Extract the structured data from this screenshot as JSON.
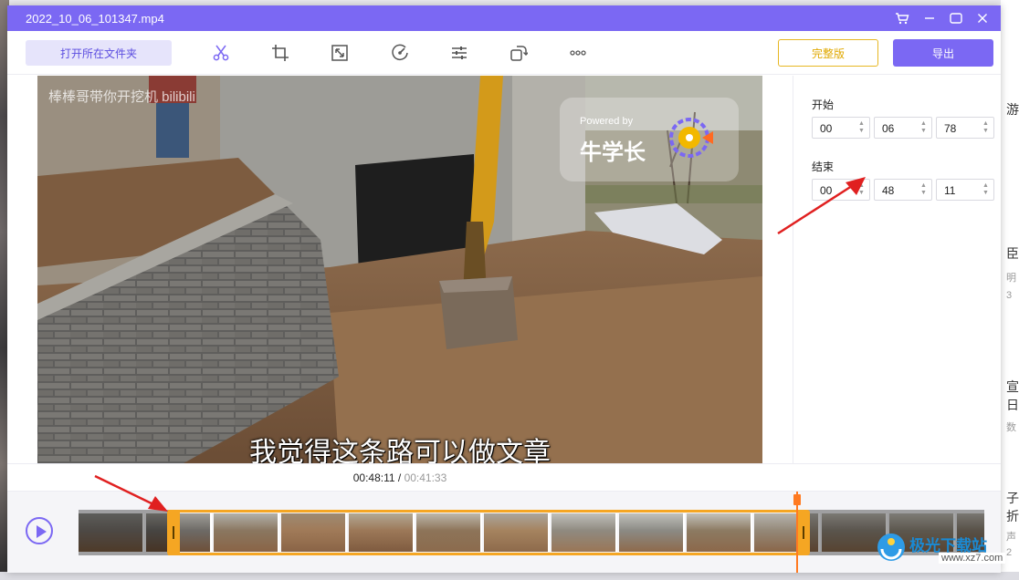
{
  "window": {
    "title": "2022_10_06_101347.mp4"
  },
  "title_controls": [
    {
      "name": "cart-icon"
    },
    {
      "name": "minimize-icon"
    },
    {
      "name": "maximize-icon"
    },
    {
      "name": "close-icon"
    }
  ],
  "toolbar": {
    "open_folder_label": "打开所在文件夹",
    "full_version_label": "完整版",
    "export_label": "导出",
    "tools": [
      "scissors-icon",
      "crop-icon",
      "resize-icon",
      "speed-icon",
      "adjust-icon",
      "rotate-icon",
      "more-icon"
    ]
  },
  "video": {
    "watermark_text": "棒棒哥带你开挖机 bilibili",
    "powered_by": "Powered by",
    "brand": "牛学长",
    "subtitle": "我觉得这条路可以做文章"
  },
  "trim_panel": {
    "start_label": "开始",
    "start": {
      "h": "00",
      "m": "06",
      "s": "78"
    },
    "end_label": "结束",
    "end": {
      "h": "00",
      "m": "48",
      "s": "11"
    }
  },
  "timeline": {
    "current_time": "00:48:11",
    "separator": " / ",
    "total_time": "00:41:33"
  },
  "overlay": {
    "site_name": "极光下载站",
    "site_url": "www.xz7.com"
  },
  "desktop_fragments": [
    "游",
    "臣",
    "明",
    "3",
    "宣",
    "日",
    "数",
    "子",
    "折",
    "声",
    "2"
  ],
  "colors": {
    "accent": "#7b68f3",
    "handle": "#f5a623",
    "playhead": "#ff7a21",
    "full_version": "#e0a800",
    "annotation_arrow": "#e02020"
  }
}
